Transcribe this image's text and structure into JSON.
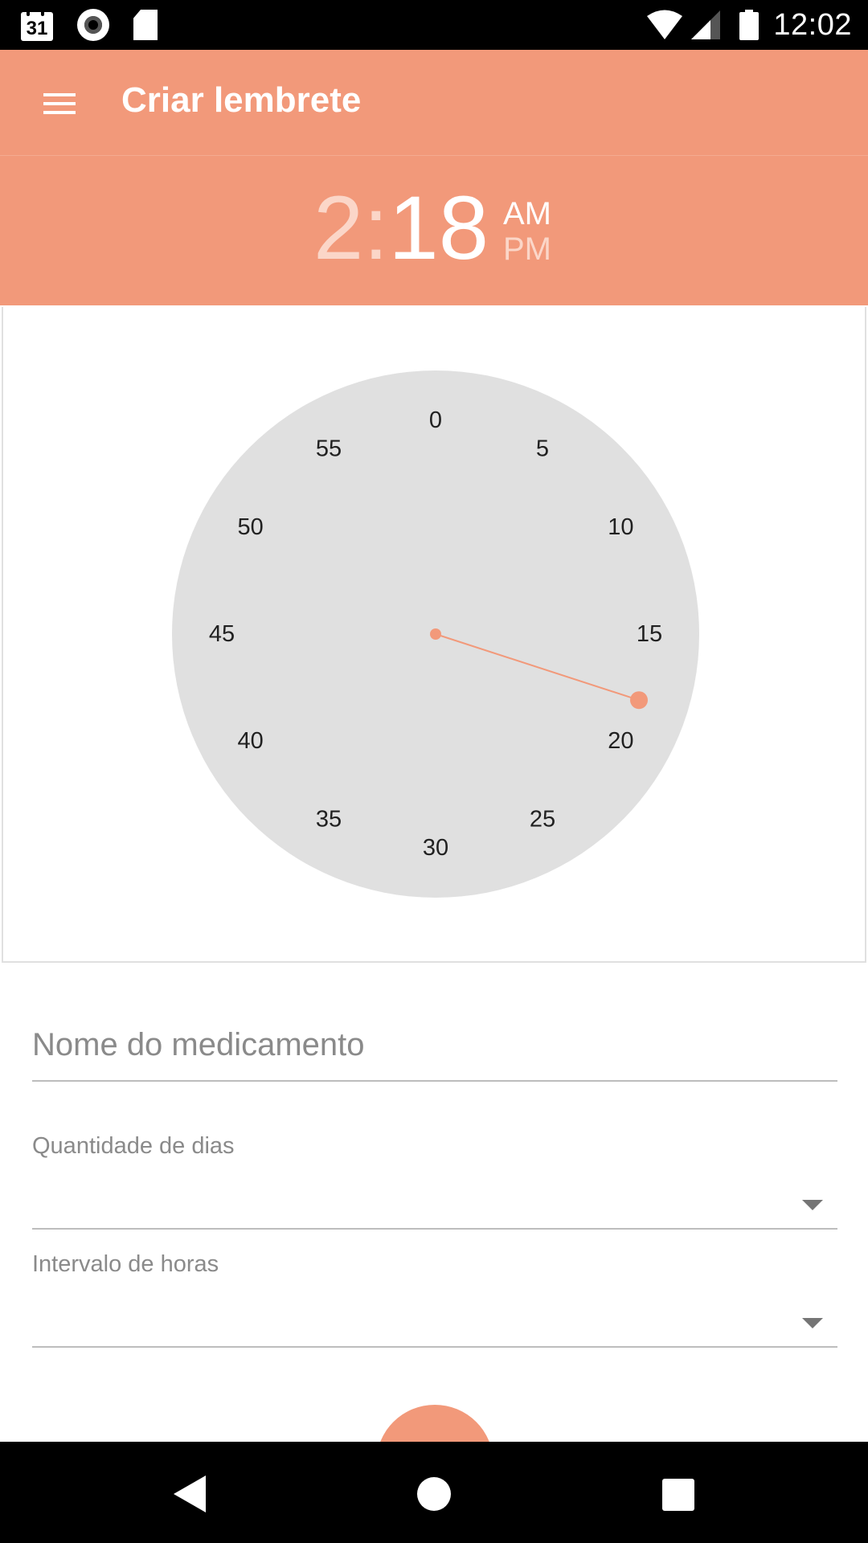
{
  "status_bar": {
    "calendar_day": "31",
    "time": "12:02",
    "icons": [
      "calendar-icon",
      "record-icon",
      "sd-card-icon",
      "wifi-icon",
      "cell-signal-icon",
      "battery-icon"
    ]
  },
  "app_bar": {
    "title": "Criar lembrete"
  },
  "time_picker": {
    "hour": "2",
    "separator": ":",
    "minute": "18",
    "am_label": "AM",
    "pm_label": "PM",
    "selected_period": "AM",
    "selected_minute": 18
  },
  "clock": {
    "labels": [
      "0",
      "5",
      "10",
      "15",
      "20",
      "25",
      "30",
      "35",
      "40",
      "45",
      "50",
      "55"
    ]
  },
  "form": {
    "medication": {
      "placeholder": "Nome do medicamento",
      "value": ""
    },
    "days": {
      "label": "Quantidade de dias",
      "value": ""
    },
    "hours_interval": {
      "label": "Intervalo de horas",
      "value": ""
    }
  },
  "colors": {
    "accent": "#f2997a",
    "dim_header_text": "#fbd6c8",
    "clock_face": "#e0e0e0"
  }
}
